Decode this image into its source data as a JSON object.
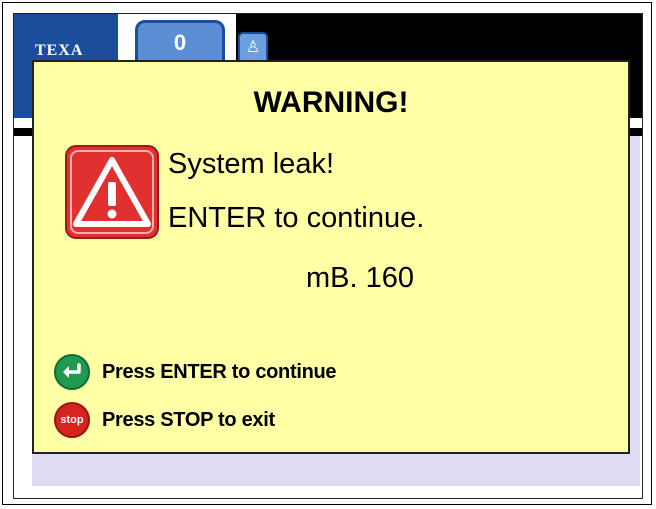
{
  "header": {
    "logo_text": "TEXA",
    "counter_value": "0",
    "user_icon": "user-icon"
  },
  "dialog": {
    "title": "WARNING!",
    "icon": "warning-triangle-icon",
    "message_line1": "System leak!",
    "message_line2": "ENTER to continue.",
    "value": "mB. 160",
    "actions": [
      {
        "icon": "enter-icon",
        "label": "Press ENTER to continue"
      },
      {
        "icon": "stop-icon",
        "icon_text": "stop",
        "label": "Press STOP to exit"
      }
    ]
  },
  "colors": {
    "dialog_bg": "#ffffa6",
    "brand_blue": "#1c4d9c",
    "warning_red": "#e03030",
    "enter_green": "#1f9a4e",
    "stop_red": "#d8231f"
  }
}
